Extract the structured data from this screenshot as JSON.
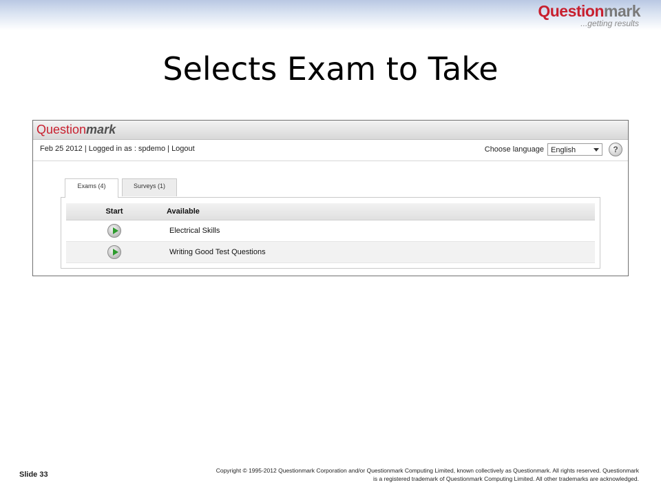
{
  "brand": {
    "logo_q": "Question",
    "logo_m": "mark",
    "tagline": "...getting results"
  },
  "slide": {
    "title": "Selects Exam to Take",
    "number_label": "Slide 33"
  },
  "app": {
    "logo_q": "Question",
    "logo_m": "mark",
    "date": "Feb 25 2012",
    "sep1": "|",
    "login_text": "Logged in as : spdemo",
    "sep2": "|",
    "logout": "Logout",
    "language_label": "Choose language",
    "language_value": "English",
    "help_icon": "?",
    "tabs": [
      {
        "label": "Exams (4)",
        "active": true
      },
      {
        "label": "Surveys (1)",
        "active": false
      }
    ],
    "table": {
      "headers": {
        "start": "Start",
        "available": "Available"
      },
      "rows": [
        {
          "name": "Electrical Skills"
        },
        {
          "name": "Writing Good Test Questions"
        }
      ]
    }
  },
  "footer": {
    "copyright_line1": "Copyright © 1995-2012 Questionmark Corporation and/or Questionmark Computing Limited, known collectively as Questionmark. All rights reserved. Questionmark",
    "copyright_line2": "is a registered trademark of Questionmark Computing Limited. All other trademarks are acknowledged."
  },
  "colors": {
    "brand_red": "#c8202f",
    "play_green": "#2e9b2e"
  }
}
